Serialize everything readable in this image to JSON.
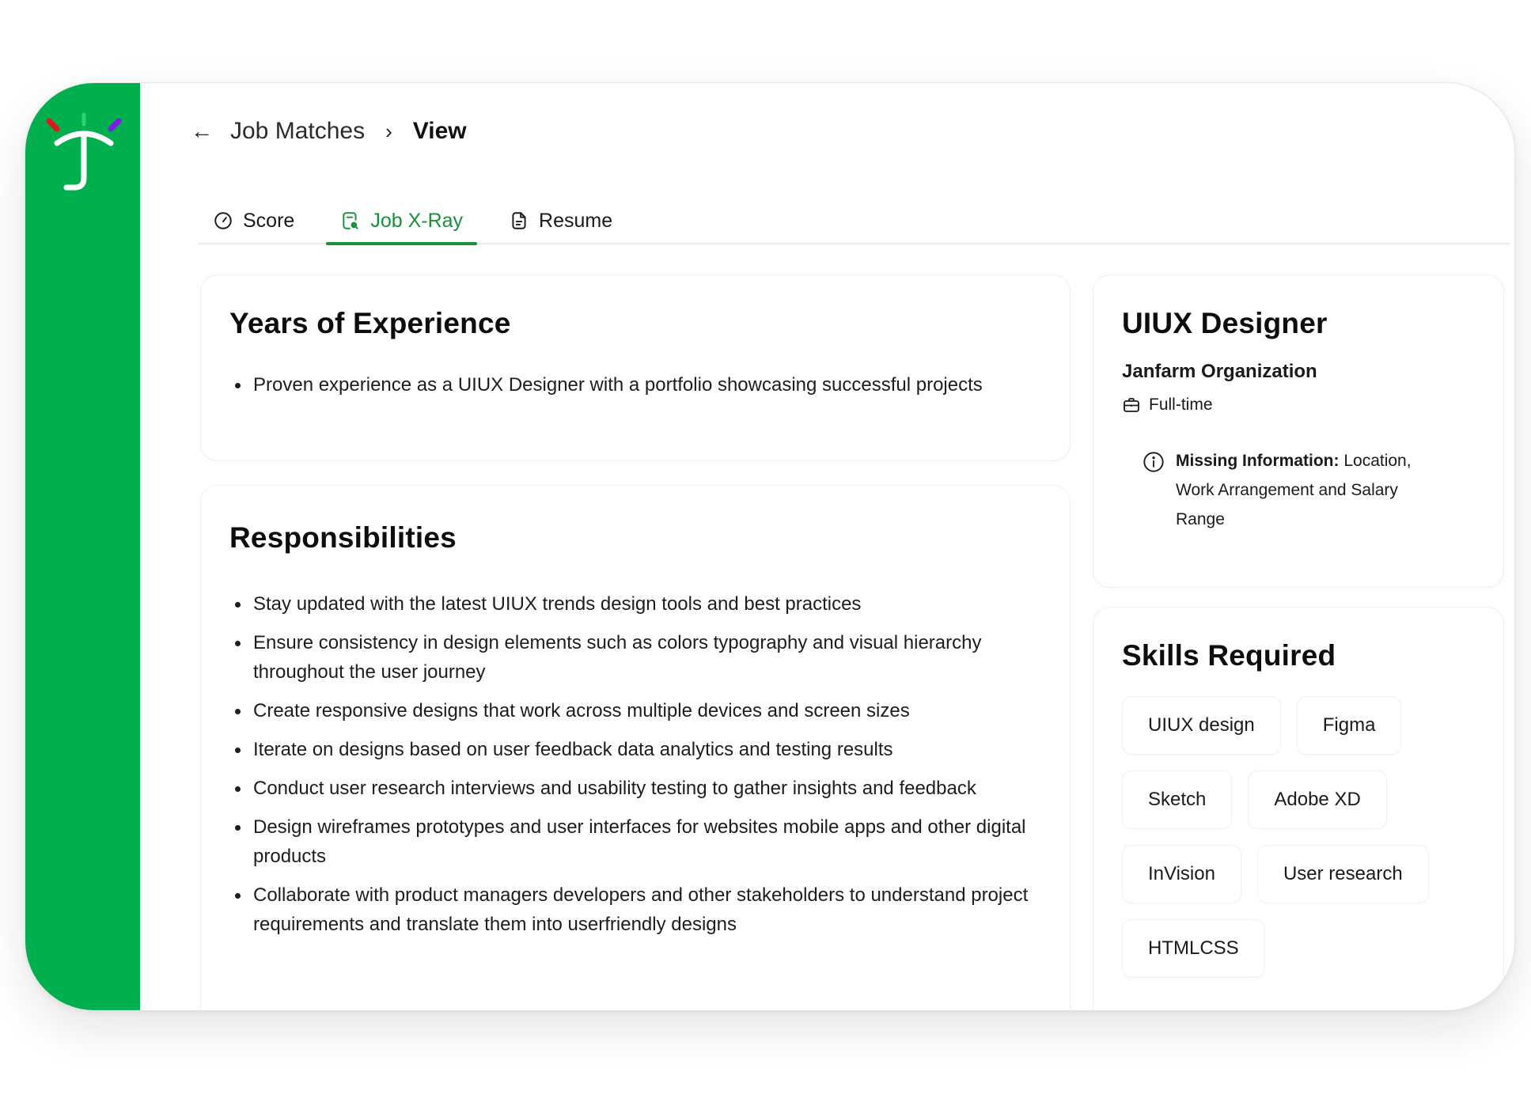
{
  "brand": {
    "primary_color": "#00b04f",
    "accent_color": "#1a8f3c",
    "logo_icon": "umbrella-j-logo"
  },
  "breadcrumb": {
    "back_icon": "arrow-left-icon",
    "parent": "Job Matches",
    "separator_icon": "chevron-right-icon",
    "current": "View"
  },
  "tabs": [
    {
      "label": "Score",
      "icon": "gauge-icon",
      "active": false
    },
    {
      "label": "Job X-Ray",
      "icon": "document-search-icon",
      "active": true
    },
    {
      "label": "Resume",
      "icon": "document-icon",
      "active": false
    }
  ],
  "experience": {
    "title": "Years of Experience",
    "items": [
      "Proven experience as a UIUX Designer with a portfolio showcasing successful projects"
    ]
  },
  "responsibilities": {
    "title": "Responsibilities",
    "items": [
      "Stay updated with the latest UIUX trends design tools and best practices",
      "Ensure consistency in design elements such as colors typography and visual hierarchy throughout the user journey",
      "Create responsive designs that work across multiple devices and screen sizes",
      "Iterate on designs based on user feedback data analytics and testing results",
      "Conduct user research interviews and usability testing to gather insights and feedback",
      "Design wireframes prototypes and user interfaces for websites mobile apps and other digital products",
      "Collaborate with product managers developers and other stakeholders to understand project requirements and translate them into userfriendly designs"
    ]
  },
  "job": {
    "title": "UIUX Designer",
    "organization": "Janfarm Organization",
    "type": "Full-time",
    "type_icon": "briefcase-icon",
    "missing_label": "Missing Information:",
    "missing_value": " Location, Work Arrangement and Salary Range",
    "missing_icon": "info-icon"
  },
  "skills": {
    "title": "Skills Required",
    "items": [
      "UIUX design",
      "Figma",
      "Sketch",
      "Adobe XD",
      "InVision",
      "User research",
      "HTMLCSS"
    ]
  }
}
